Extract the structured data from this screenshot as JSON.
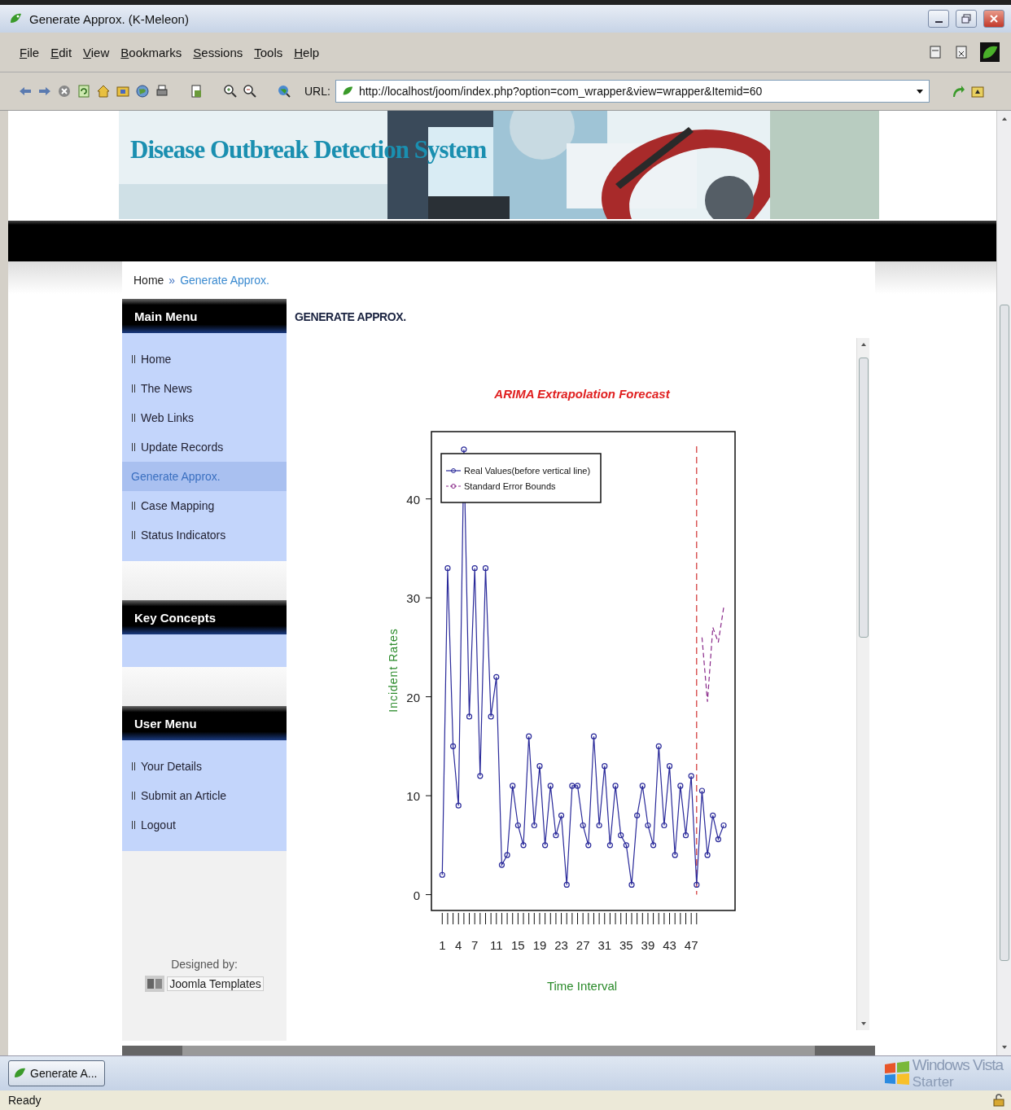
{
  "window": {
    "title": "Generate Approx. (K-Meleon)"
  },
  "menu_bar": [
    {
      "label": "File"
    },
    {
      "label": "Edit"
    },
    {
      "label": "View"
    },
    {
      "label": "Bookmarks"
    },
    {
      "label": "Sessions"
    },
    {
      "label": "Tools"
    },
    {
      "label": "Help"
    }
  ],
  "address_bar": {
    "label": "URL:",
    "value": "http://localhost/joom/index.php?option=com_wrapper&view=wrapper&Itemid=60"
  },
  "site": {
    "title": "Disease Outbreak Detection System"
  },
  "breadcrumb": {
    "items": [
      {
        "label": "Home",
        "selected": false
      },
      {
        "label": "Generate Approx.",
        "selected": true
      }
    ],
    "separator": "»"
  },
  "sidebar": [
    {
      "title": "Main Menu",
      "items": [
        {
          "label": "Home",
          "selected": false
        },
        {
          "label": "The News",
          "selected": false
        },
        {
          "label": "Web Links",
          "selected": false
        },
        {
          "label": "Update Records",
          "selected": false
        },
        {
          "label": "Generate Approx.",
          "selected": true
        },
        {
          "label": "Case Mapping",
          "selected": false
        },
        {
          "label": "Status Indicators",
          "selected": false
        }
      ]
    },
    {
      "title": "Key Concepts"
    },
    {
      "title": "User Menu",
      "items": [
        {
          "label": "Your Details",
          "selected": false
        },
        {
          "label": "Submit an Article",
          "selected": false
        },
        {
          "label": "Logout",
          "selected": false
        }
      ]
    }
  ],
  "credit": {
    "label": "Designed by:",
    "link": "Joomla Templates"
  },
  "content": {
    "heading": "GENERATE APPROX.",
    "chart_data": {
      "type": "line",
      "title": "ARIMA Extrapolation Forecast",
      "xlabel": "Time Interval",
      "ylabel": "Incident Rates",
      "x": [
        1,
        2,
        3,
        4,
        5,
        6,
        7,
        8,
        9,
        10,
        11,
        12,
        13,
        14,
        15,
        16,
        17,
        18,
        19,
        20,
        21,
        22,
        23,
        24,
        25,
        26,
        27,
        28,
        29,
        30,
        31,
        32,
        33,
        34,
        35,
        36,
        37,
        38,
        39,
        40,
        41,
        42,
        43,
        44,
        45,
        46,
        47,
        48,
        49,
        50,
        51,
        52,
        53
      ],
      "series": [
        {
          "name": "Real Values(before vertical line)",
          "color": "#2a2a9a",
          "marker": "circle",
          "values": [
            2,
            33,
            15,
            9,
            45,
            18,
            33,
            12,
            33,
            18,
            22,
            3,
            4,
            11,
            7,
            5,
            16,
            7,
            13,
            5,
            11,
            6,
            8,
            1,
            11,
            11,
            7,
            5,
            16,
            7,
            13,
            5,
            11,
            6,
            5,
            1,
            8,
            11,
            7,
            5,
            15,
            7,
            13,
            4,
            11,
            6,
            12,
            1,
            10.5,
            4,
            8,
            5.6,
            7
          ]
        },
        {
          "name": "Standard Error Bounds",
          "color": "#8a2a8a",
          "line_style": "dashed",
          "values": [
            null,
            null,
            null,
            null,
            null,
            null,
            null,
            null,
            null,
            null,
            null,
            null,
            null,
            null,
            null,
            null,
            null,
            null,
            null,
            null,
            null,
            null,
            null,
            null,
            null,
            null,
            null,
            null,
            null,
            null,
            null,
            null,
            null,
            null,
            null,
            null,
            null,
            null,
            null,
            null,
            null,
            null,
            null,
            null,
            null,
            null,
            null,
            null,
            26,
            19.5,
            27,
            25.5,
            29
          ]
        }
      ],
      "xlim": [
        -1,
        55.1
      ],
      "ylim": [
        -1.6,
        46.8
      ],
      "xticks": [
        1,
        4,
        7,
        11,
        15,
        19,
        23,
        27,
        31,
        35,
        39,
        43,
        47
      ],
      "yticks": [
        0,
        10,
        20,
        30,
        40
      ],
      "legend": "upper left",
      "ref_lines": [
        {
          "axis": "x",
          "value": 48,
          "color": "#d03030"
        }
      ]
    }
  },
  "taskbar": {
    "items": [
      {
        "label": "Generate A...",
        "selected": false
      }
    ],
    "logo": {
      "name": "Windows Vista",
      "edition": "Starter"
    }
  },
  "status_bar": {
    "text": "Ready"
  }
}
